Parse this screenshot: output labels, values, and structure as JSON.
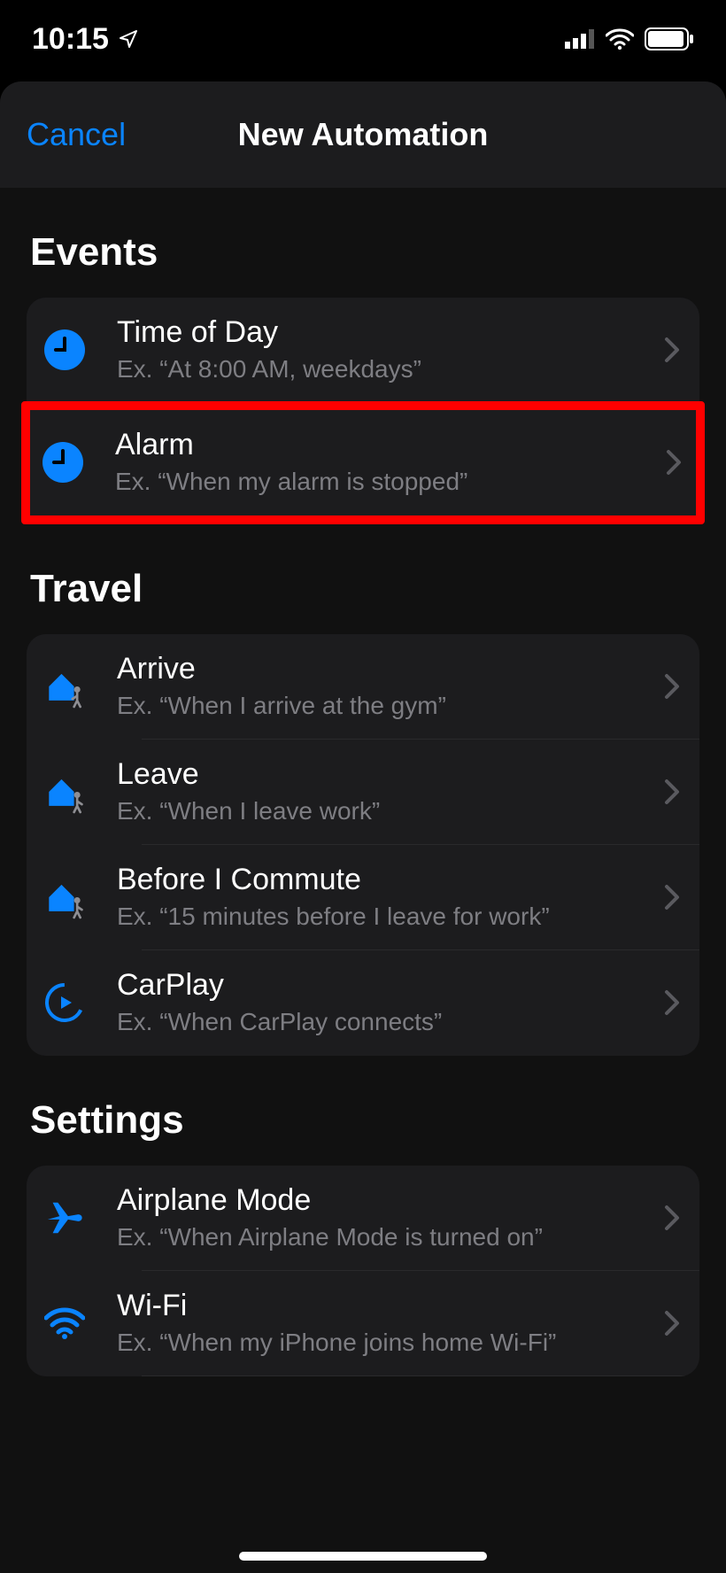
{
  "status": {
    "time": "10:15"
  },
  "header": {
    "cancel": "Cancel",
    "title": "New Automation"
  },
  "sections": {
    "events": {
      "title": "Events",
      "items": [
        {
          "title": "Time of Day",
          "sub": "Ex. “At 8:00 AM, weekdays”"
        },
        {
          "title": "Alarm",
          "sub": "Ex. “When my alarm is stopped”"
        }
      ]
    },
    "travel": {
      "title": "Travel",
      "items": [
        {
          "title": "Arrive",
          "sub": "Ex. “When I arrive at the gym”"
        },
        {
          "title": "Leave",
          "sub": "Ex. “When I leave work”"
        },
        {
          "title": "Before I Commute",
          "sub": "Ex. “15 minutes before I leave for work”"
        },
        {
          "title": "CarPlay",
          "sub": "Ex. “When CarPlay connects”"
        }
      ]
    },
    "settings": {
      "title": "Settings",
      "items": [
        {
          "title": "Airplane Mode",
          "sub": "Ex. “When Airplane Mode is turned on”"
        },
        {
          "title": "Wi-Fi",
          "sub": "Ex. “When my iPhone joins home Wi-Fi”"
        }
      ]
    }
  },
  "colors": {
    "accent": "#0a84ff",
    "iconBlue": "#0a84ff"
  }
}
